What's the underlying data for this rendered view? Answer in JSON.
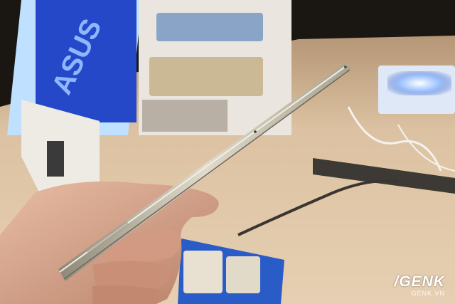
{
  "watermark": {
    "logo": "/GENK",
    "url": "GENK.VN"
  },
  "sign": {
    "brand_text": "ASUS"
  },
  "colors": {
    "table": "#d9bfa0",
    "blue_panel": "#2448c8",
    "phone_body": "#c9c2b0",
    "skin": "#d8a78e",
    "background": "#1a1612"
  }
}
